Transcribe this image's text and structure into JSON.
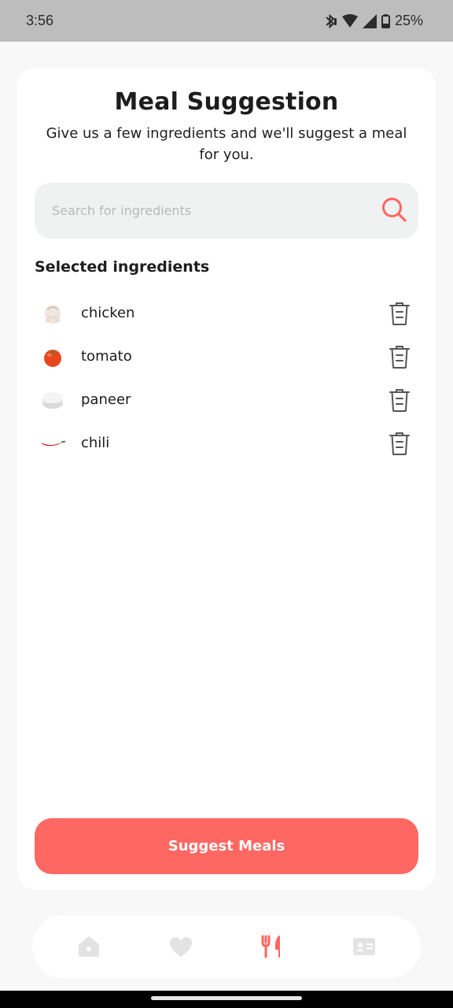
{
  "status_bar": {
    "time": "3:56",
    "battery": "25%",
    "icons": [
      "bluetooth-icon",
      "wifi-icon",
      "signal-icon",
      "battery-icon"
    ]
  },
  "header": {
    "title": "Meal Suggestion",
    "subtitle": "Give us a few ingredients and we'll suggest a meal for you."
  },
  "search": {
    "placeholder": "Search for ingredients",
    "value": "",
    "icon": "search-icon"
  },
  "selected": {
    "heading": "Selected ingredients",
    "items": [
      {
        "name": "chicken",
        "icon": "chicken-image"
      },
      {
        "name": "tomato",
        "icon": "tomato-image"
      },
      {
        "name": "paneer",
        "icon": "paneer-image"
      },
      {
        "name": "chili",
        "icon": "chili-image"
      }
    ]
  },
  "actions": {
    "suggest_label": "Suggest Meals"
  },
  "nav": {
    "items": [
      {
        "name": "home",
        "icon": "home-icon",
        "active": false
      },
      {
        "name": "favorites",
        "icon": "heart-icon",
        "active": false
      },
      {
        "name": "meal-suggestion",
        "icon": "fork-knife-icon",
        "active": true
      },
      {
        "name": "profile",
        "icon": "id-card-icon",
        "active": false
      }
    ]
  },
  "colors": {
    "accent": "#ff6762",
    "nav_inactive": "#e3e3e3",
    "search_bg": "#f0f1f1"
  }
}
